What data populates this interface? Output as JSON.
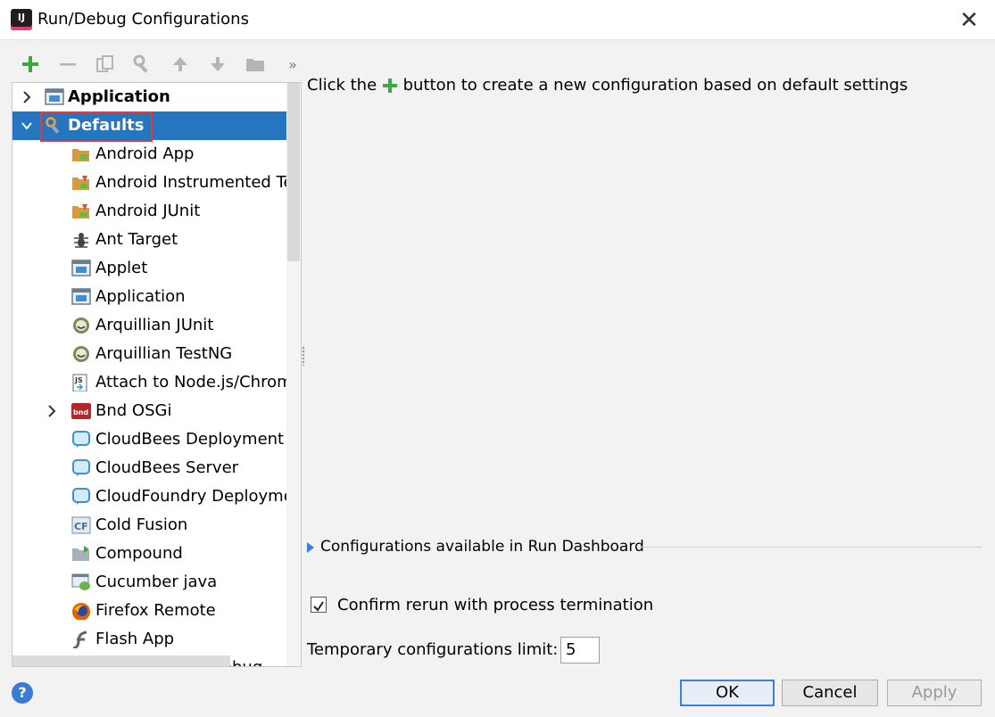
{
  "window": {
    "title": "Run/Debug Configurations",
    "app_icon_text": "IJ"
  },
  "toolbar": {
    "more_label": "»"
  },
  "tree": {
    "items": [
      {
        "label": "Application",
        "expanded": false,
        "bold": true
      },
      {
        "label": "Defaults",
        "expanded": true,
        "bold": true,
        "selected": true
      },
      {
        "label": "Android App"
      },
      {
        "label": "Android Instrumented Tests"
      },
      {
        "label": "Android JUnit"
      },
      {
        "label": "Ant Target"
      },
      {
        "label": "Applet"
      },
      {
        "label": "Application"
      },
      {
        "label": "Arquillian JUnit"
      },
      {
        "label": "Arquillian TestNG"
      },
      {
        "label": "Attach to Node.js/Chrome"
      },
      {
        "label": "Bnd OSGi",
        "expandable": true
      },
      {
        "label": "CloudBees Deployment"
      },
      {
        "label": "CloudBees Server"
      },
      {
        "label": "CloudFoundry Deployment"
      },
      {
        "label": "Cold Fusion"
      },
      {
        "label": "Compound"
      },
      {
        "label": "Cucumber java"
      },
      {
        "label": "Firefox Remote"
      },
      {
        "label": "Flash App"
      },
      {
        "label": "Flash Remote Debug"
      }
    ]
  },
  "main": {
    "hint_before": "Click the",
    "hint_after": "button to create a new configuration based on default settings",
    "dashboard_label": "Configurations available in Run Dashboard",
    "confirm_rerun_label": "Confirm rerun with process termination",
    "confirm_rerun_checked": true,
    "temp_limit_label": "Temporary configurations limit:",
    "temp_limit_value": "5"
  },
  "footer": {
    "help_label": "?",
    "ok_label": "OK",
    "cancel_label": "Cancel",
    "apply_label": "Apply"
  },
  "colors": {
    "selection": "#2675bf",
    "accent_green": "#3aa843",
    "highlight_red": "#e0393e"
  }
}
